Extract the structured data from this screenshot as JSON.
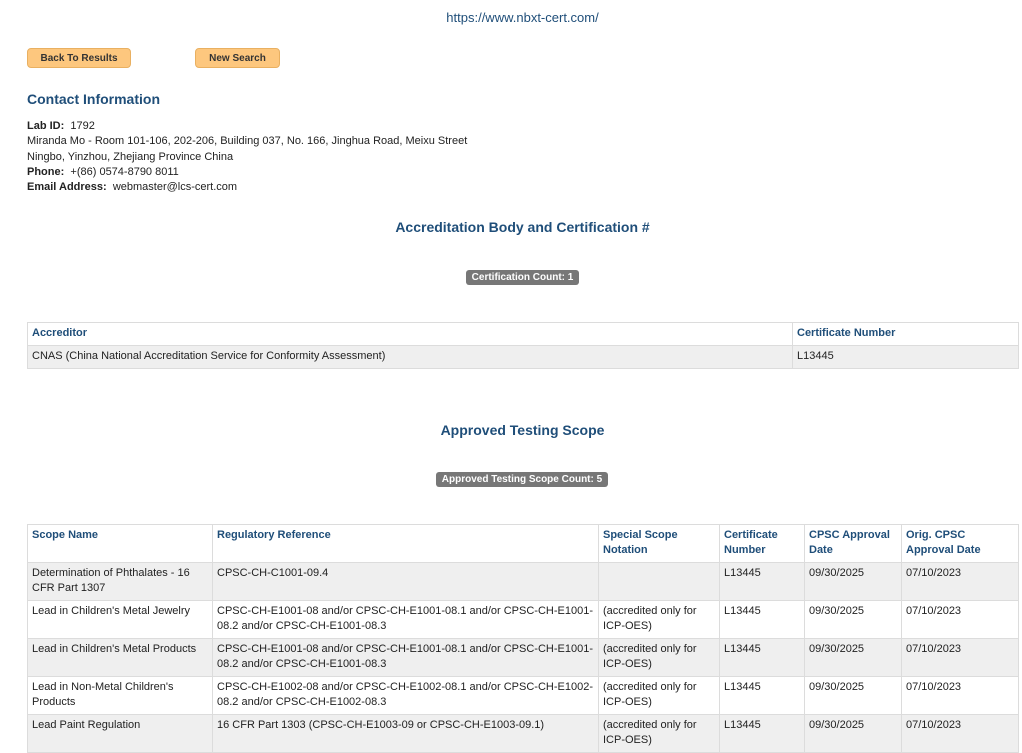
{
  "url_text": "https://www.nbxt-cert.com/",
  "buttons": {
    "back": "Back To Results",
    "new_search": "New Search"
  },
  "contact": {
    "heading": "Contact Information",
    "lab_id_label": "Lab ID:",
    "lab_id": "1792",
    "address_line1": "Miranda Mo - Room 101-106, 202-206, Building 037, No. 166, Jinghua Road, Meixu Street",
    "address_line2": "Ningbo, Yinzhou, Zhejiang Province China",
    "phone_label": "Phone:",
    "phone": "+(86) 0574-8790 8011",
    "email_label": "Email Address:",
    "email": "webmaster@lcs-cert.com"
  },
  "accreditation": {
    "heading": "Accreditation Body and Certification #",
    "badge": "Certification Count: 1",
    "columns": [
      "Accreditor",
      "Certificate Number"
    ],
    "rows": [
      [
        "CNAS (China National Accreditation Service for Conformity Assessment)",
        "L13445"
      ]
    ]
  },
  "scope": {
    "heading": "Approved Testing Scope",
    "badge": "Approved Testing Scope Count: 5",
    "columns": [
      "Scope Name",
      "Regulatory Reference",
      "Special Scope Notation",
      "Certificate Number",
      "CPSC Approval Date",
      "Orig. CPSC Approval Date"
    ],
    "rows": [
      [
        "Determination of Phthalates - 16 CFR Part 1307",
        "CPSC-CH-C1001-09.4",
        "",
        "L13445",
        "09/30/2025",
        "07/10/2023"
      ],
      [
        "Lead in Children's Metal Jewelry",
        "CPSC-CH-E1001-08 and/or CPSC-CH-E1001-08.1 and/or CPSC-CH-E1001-08.2 and/or CPSC-CH-E1001-08.3",
        "(accredited only for ICP-OES)",
        "L13445",
        "09/30/2025",
        "07/10/2023"
      ],
      [
        "Lead in Children's Metal Products",
        "CPSC-CH-E1001-08 and/or CPSC-CH-E1001-08.1 and/or CPSC-CH-E1001-08.2 and/or CPSC-CH-E1001-08.3",
        "(accredited only for ICP-OES)",
        "L13445",
        "09/30/2025",
        "07/10/2023"
      ],
      [
        "Lead in Non-Metal Children's Products",
        "CPSC-CH-E1002-08 and/or CPSC-CH-E1002-08.1 and/or CPSC-CH-E1002-08.2 and/or CPSC-CH-E1002-08.3",
        "(accredited only for ICP-OES)",
        "L13445",
        "09/30/2025",
        "07/10/2023"
      ],
      [
        "Lead Paint Regulation",
        "16 CFR Part 1303 (CPSC-CH-E1003-09 or CPSC-CH-E1003-09.1)",
        "(accredited only for ICP-OES)",
        "L13445",
        "09/30/2025",
        "07/10/2023"
      ]
    ]
  }
}
